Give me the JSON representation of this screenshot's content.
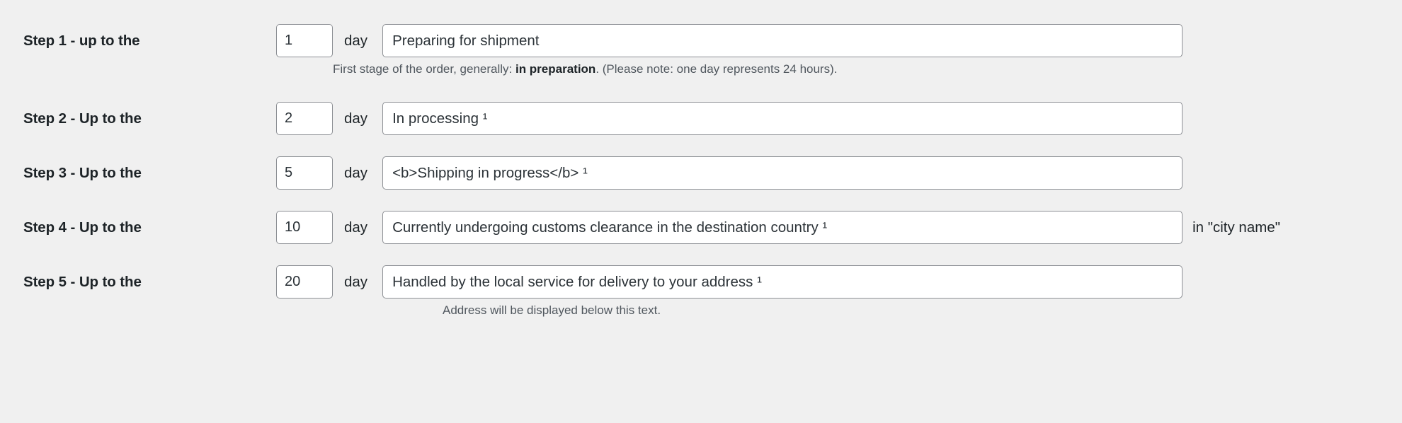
{
  "page": {
    "background_color": "#f0f0f0",
    "border_color": "#8c8f94",
    "input_background": "#ffffff",
    "label_color": "#1d2327",
    "hint_color": "#50575e"
  },
  "day_unit_label": "day",
  "steps": [
    {
      "label": "Step 1 - up to the",
      "days_value": "1",
      "days_placeholder": "",
      "message_value": "Preparing for shipment",
      "message_placeholder": "",
      "suffix": "",
      "hint_before": "First stage of the order, generally: ",
      "hint_bold": "in preparation",
      "hint_after": ". (Please note: one day represents 24 hours)."
    },
    {
      "label": "Step 2 - Up to the",
      "days_value": "2",
      "days_placeholder": "",
      "message_value": "In processing ¹",
      "message_placeholder": "",
      "suffix": "",
      "hint_before": "",
      "hint_bold": "",
      "hint_after": ""
    },
    {
      "label": "Step 3 - Up to the",
      "days_value": "5",
      "days_placeholder": "",
      "message_value": "<b>Shipping in progress</b> ¹",
      "message_placeholder": "",
      "suffix": "",
      "hint_before": "",
      "hint_bold": "",
      "hint_after": ""
    },
    {
      "label": "Step 4 - Up to the",
      "days_value": "10",
      "days_placeholder": "",
      "message_value": "Currently undergoing customs clearance in the destination country ¹",
      "message_placeholder": "",
      "suffix": "in \"city name\"",
      "hint_before": "",
      "hint_bold": "",
      "hint_after": ""
    },
    {
      "label": "Step 5 - Up to the",
      "days_value": "20",
      "days_placeholder": "",
      "message_value": "Handled by the local service for delivery to your address ¹",
      "message_placeholder": "",
      "suffix": "",
      "hint_before": "Address will be displayed below this text.",
      "hint_bold": "",
      "hint_after": ""
    }
  ]
}
